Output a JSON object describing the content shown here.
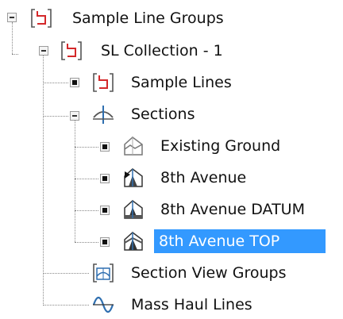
{
  "tree": {
    "root": {
      "label": "Sample Line Groups",
      "icon": "sample-line-group-icon",
      "expanded": true
    },
    "collection": {
      "label": "SL Collection - 1",
      "icon": "sample-line-group-icon",
      "expanded": true
    },
    "sample_lines": {
      "label": "Sample Lines",
      "icon": "sample-line-icon"
    },
    "sections": {
      "label": "Sections",
      "icon": "section-icon",
      "expanded": true
    },
    "section_items": [
      {
        "label": "Existing Ground",
        "icon": "section-surface-icon"
      },
      {
        "label": "8th Avenue",
        "icon": "section-corridor-icon"
      },
      {
        "label": "8th Avenue DATUM",
        "icon": "section-corridor-datum-icon"
      },
      {
        "label": "8th Avenue TOP",
        "icon": "section-corridor-top-icon",
        "selected": true
      }
    ],
    "section_view_groups": {
      "label": "Section View Groups",
      "icon": "section-view-group-icon"
    },
    "mass_haul_lines": {
      "label": "Mass Haul Lines",
      "icon": "mass-haul-line-icon"
    }
  },
  "colors": {
    "selection": "#3399ff",
    "icon_red": "#d4282a",
    "icon_blue": "#2f6fb0",
    "connector": "#888888"
  }
}
